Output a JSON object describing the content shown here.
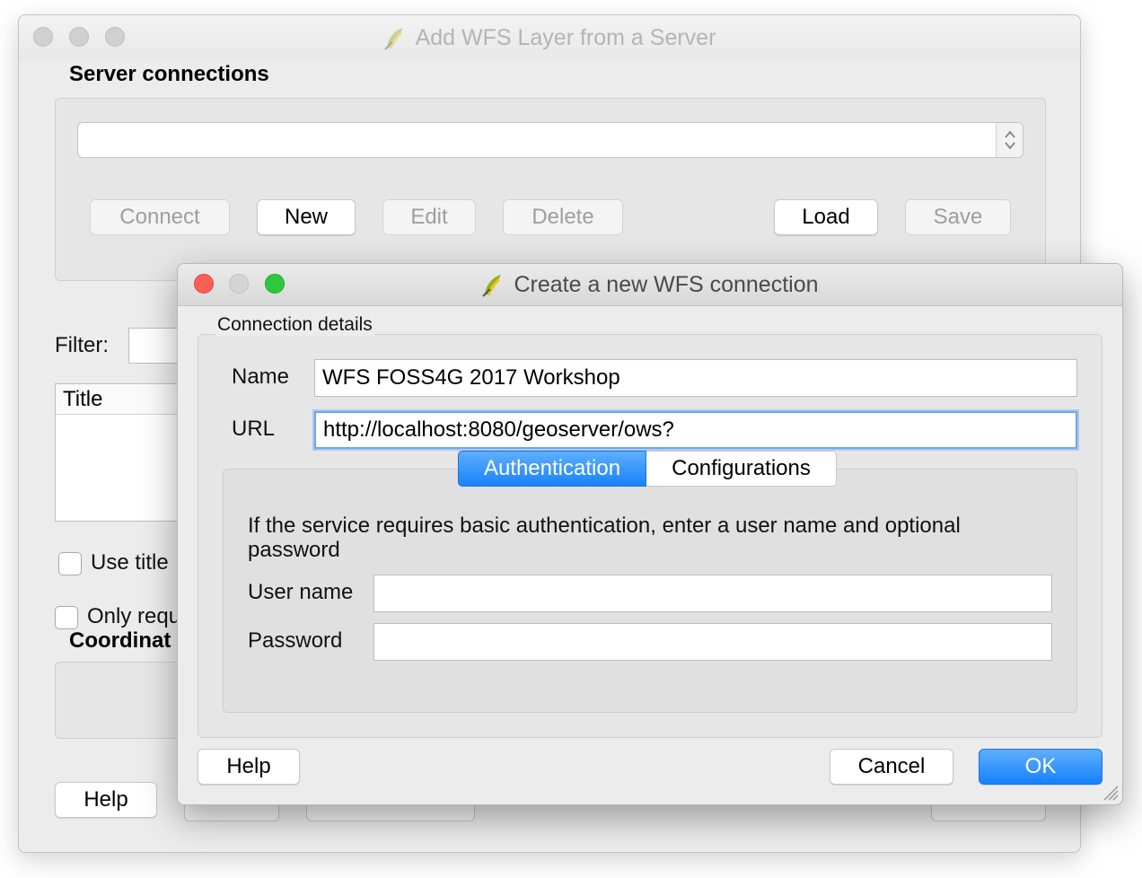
{
  "background_window": {
    "title": "Add WFS Layer from a Server",
    "server_connections_label": "Server connections",
    "connection_select_value": "",
    "buttons": {
      "connect": "Connect",
      "new": "New",
      "edit": "Edit",
      "delete": "Delete",
      "load": "Load",
      "save": "Save"
    },
    "filter_label": "Filter:",
    "table_header_title": "Title",
    "checkbox_use_title": "Use title",
    "checkbox_only_request": "Only requ",
    "coordinate_label": "Coordinat",
    "help_button": "Help"
  },
  "dialog": {
    "title": "Create a new WFS connection",
    "group_title": "Connection details",
    "name_label": "Name",
    "name_value": "WFS FOSS4G 2017 Workshop",
    "url_label": "URL",
    "url_value": "http://localhost:8080/geoserver/ows?",
    "tabs": [
      {
        "label": "Authentication",
        "active": true
      },
      {
        "label": "Configurations",
        "active": false
      }
    ],
    "auth_message": "If the service requires basic authentication, enter a user name and optional password",
    "username_label": "User name",
    "username_value": "",
    "password_label": "Password",
    "password_value": "",
    "buttons": {
      "help": "Help",
      "cancel": "Cancel",
      "ok": "OK"
    }
  },
  "colors": {
    "accent": "#1a82fb",
    "window_bg": "#ececec",
    "close_red": "#fc5f57",
    "zoom_green": "#2dc840"
  }
}
